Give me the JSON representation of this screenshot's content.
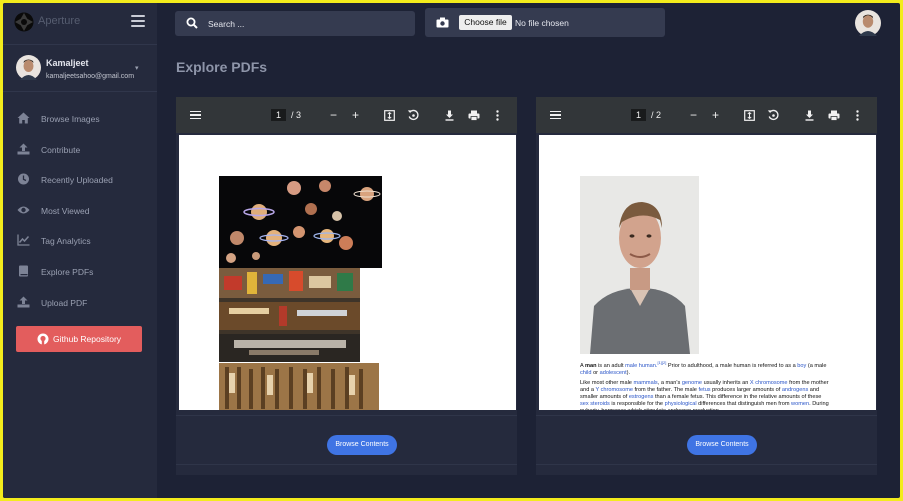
{
  "brand": {
    "name": "Aperture"
  },
  "user": {
    "name": "Kamaljeet",
    "email": "kamaljeetsahoo@gmail.com"
  },
  "nav": {
    "items": [
      {
        "label": "Browse Images",
        "icon": "home-icon"
      },
      {
        "label": "Contribute",
        "icon": "upload-icon"
      },
      {
        "label": "Recently Uploaded",
        "icon": "clock-icon"
      },
      {
        "label": "Most Viewed",
        "icon": "eye-icon"
      },
      {
        "label": "Tag Analytics",
        "icon": "chart-icon"
      },
      {
        "label": "Explore PDFs",
        "icon": "book-icon"
      },
      {
        "label": "Upload PDF",
        "icon": "upload-icon"
      }
    ],
    "github_label": "Github Repository"
  },
  "search": {
    "placeholder": "Search ..."
  },
  "upload": {
    "button_label": "Choose file",
    "status": "No file chosen"
  },
  "page": {
    "title": "Explore PDFs"
  },
  "pdfs": [
    {
      "page_current": "1",
      "page_sep": "/",
      "page_total": "3",
      "browse_label": "Browse Contents"
    },
    {
      "page_current": "1",
      "page_sep": "/",
      "page_total": "2",
      "browse_label": "Browse Contents",
      "text_p1_a": "A ",
      "text_p1_b": "man",
      "text_p1_c": " is an adult ",
      "text_p1_link1": "male",
      "text_p1_d": " ",
      "text_p1_link2": "human.",
      "text_p1_sup": "[1][2]",
      "text_p1_e": " Prior to adulthood, a male human is referred to as a ",
      "text_p1_link3": "boy",
      "text_p1_f": " (a male ",
      "text_p1_link4": "child",
      "text_p1_g": " or ",
      "text_p1_link5": "adolescent",
      "text_p1_h": ").",
      "text_p2_a": "Like most other male ",
      "text_p2_link1": "mammals",
      "text_p2_b": ", a man's ",
      "text_p2_link2": "genome",
      "text_p2_c": " usually inherits an ",
      "text_p2_link3": "X chromosome",
      "text_p2_d": " from the mother and a ",
      "text_p2_link4": "Y chromosome",
      "text_p2_e": " from the father. The male ",
      "text_p2_link5": "fetus",
      "text_p2_f": " produces larger amounts of ",
      "text_p2_link6": "androgens",
      "text_p2_g": " and smaller amounts of ",
      "text_p2_link7": "estrogens",
      "text_p2_h": " than a female fetus. This difference in the relative amounts of these ",
      "text_p2_link8": "sex steroids",
      "text_p2_i": " is responsible for the ",
      "text_p2_link9": "physiological",
      "text_p2_j": " differences that distinguish men from ",
      "text_p2_link10": "women",
      "text_p2_k": ". During puberty, hormones which stimulate androgen production"
    }
  ]
}
